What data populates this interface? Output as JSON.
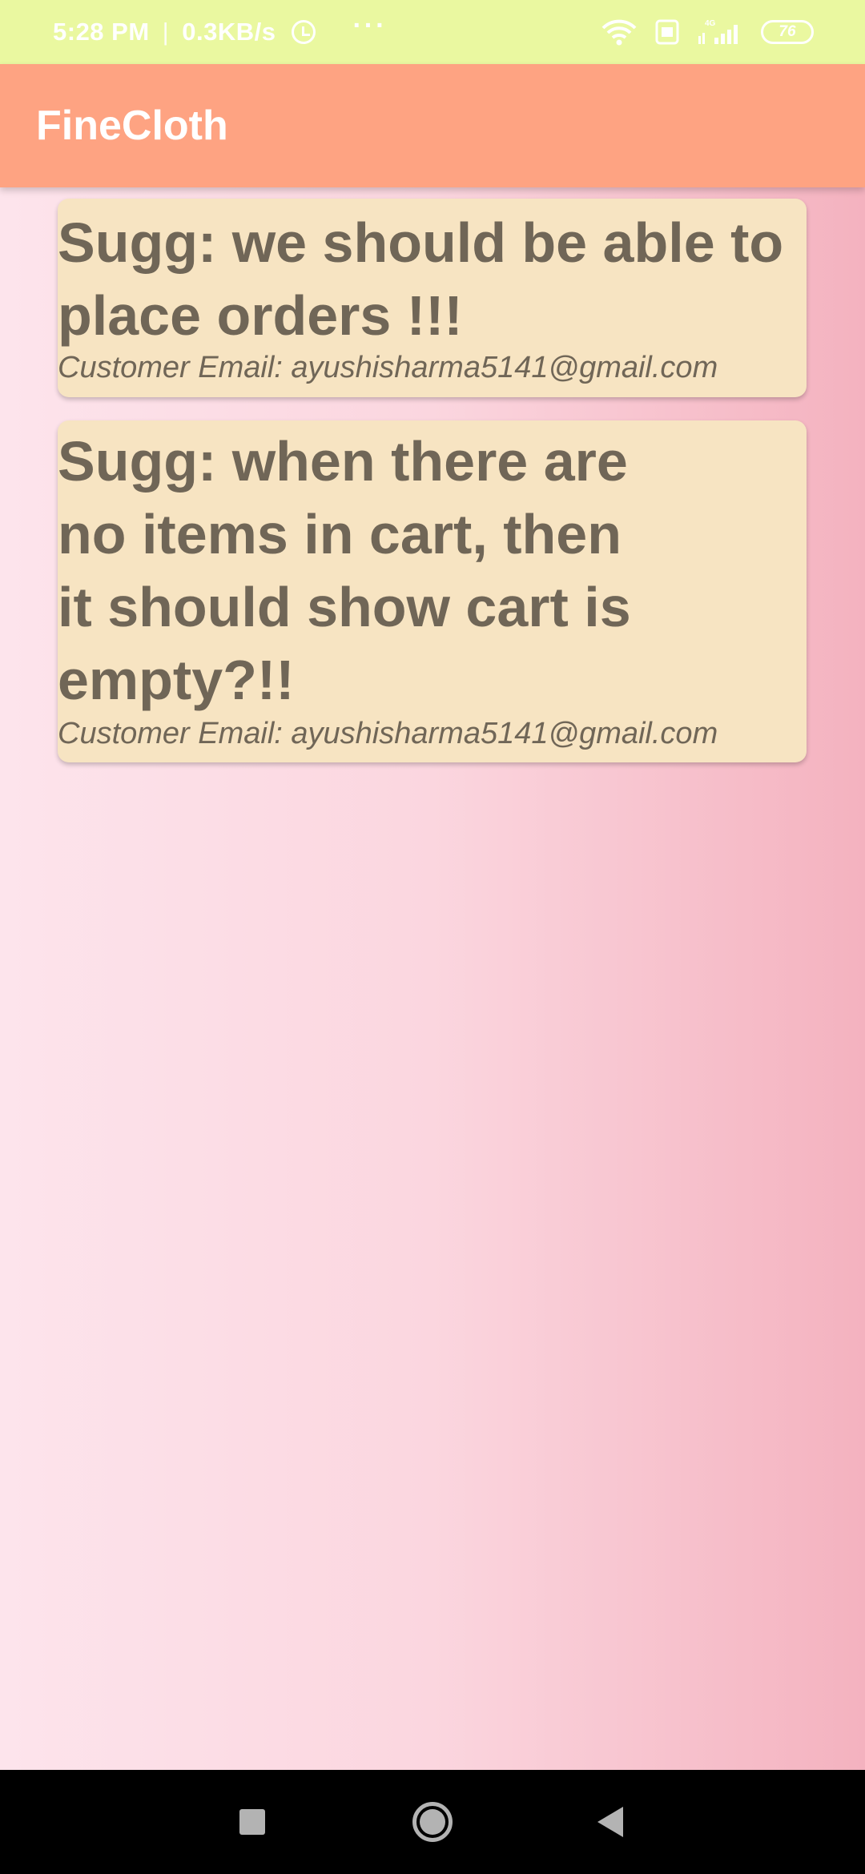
{
  "status_bar": {
    "time": "5:28 PM",
    "separator": "|",
    "net_speed": "0.3KB/s",
    "more": "···",
    "network_type": "4G",
    "battery": "76",
    "icons": [
      "alarm-icon",
      "more-icon",
      "wifi-icon",
      "sim-icon",
      "signal-icon",
      "battery-icon"
    ]
  },
  "app_bar": {
    "title": "FineCloth",
    "color": "#fea382"
  },
  "suggestions": [
    {
      "text": "Sugg: we should be able to\nplace orders !!!",
      "email": "Customer Email: ayushisharma5141@gmail.com"
    },
    {
      "text": "Sugg: when there are\nno items in cart, then\nit should show cart is\nempty?!!",
      "email": "Customer Email: ayushisharma5141@gmail.com"
    }
  ],
  "nav_bar": {
    "icons": [
      "recents-icon",
      "home-icon",
      "back-icon"
    ]
  },
  "colors": {
    "status_bar_bg": "#eaf8a0",
    "card_bg": "#f7e4c2",
    "card_text": "#706657",
    "background_gradient_start": "#fde4ec",
    "background_gradient_end": "#f4b2bf"
  }
}
